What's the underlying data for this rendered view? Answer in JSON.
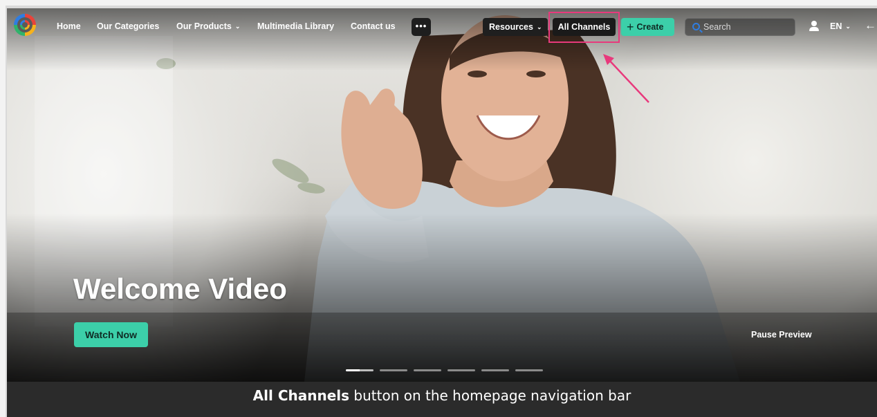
{
  "nav": {
    "items": [
      {
        "label": "Home"
      },
      {
        "label": "Our Categories"
      },
      {
        "label": "Our Products",
        "has_dropdown": true
      },
      {
        "label": "Multimedia Library"
      },
      {
        "label": "Contact us"
      }
    ],
    "more_label": "•••",
    "resources_label": "Resources",
    "all_channels_label": "All Channels",
    "create_label": "Create",
    "search_placeholder": "Search",
    "language": "EN",
    "exit_glyph": "←|",
    "chevron": "⌄"
  },
  "hero": {
    "title": "Welcome Video",
    "watch_now_label": "Watch Now",
    "pause_preview_label": "Pause Preview",
    "slide_count": 6,
    "active_slide": 1
  },
  "caption": {
    "emphasis": "All Channels",
    "rest": " button on the homepage navigation bar"
  },
  "colors": {
    "accent_teal": "#3ccfa9",
    "highlight_pink": "#e8397c",
    "search_blue": "#2f7de1"
  }
}
